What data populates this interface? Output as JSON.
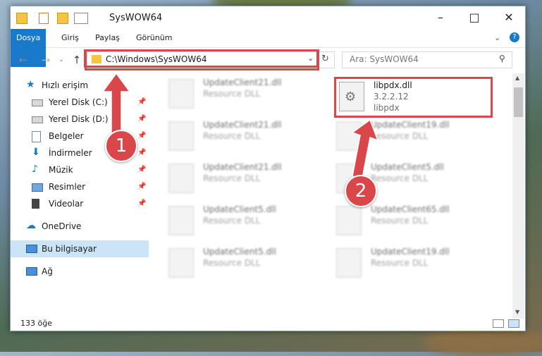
{
  "window": {
    "title": "SysWOW64"
  },
  "ribbon": {
    "tabs": [
      "Dosya",
      "Giriş",
      "Paylaş",
      "Görünüm"
    ]
  },
  "address": {
    "path": "C:\\Windows\\SysWOW64",
    "search_placeholder": "Ara: SysWOW64"
  },
  "sidebar": {
    "items": [
      {
        "label": "Hızlı erişim",
        "icon": "star-icon"
      },
      {
        "label": "Yerel Disk (C:)",
        "icon": "drive-icon",
        "pinned": true
      },
      {
        "label": "Yerel Disk (D:)",
        "icon": "drive-icon",
        "pinned": true
      },
      {
        "label": "Belgeler",
        "icon": "documents-icon",
        "pinned": true
      },
      {
        "label": "İndirmeler",
        "icon": "download-icon",
        "pinned": true
      },
      {
        "label": "Müzik",
        "icon": "music-icon",
        "pinned": true
      },
      {
        "label": "Resimler",
        "icon": "pictures-icon",
        "pinned": true
      },
      {
        "label": "Videolar",
        "icon": "video-icon",
        "pinned": true
      },
      {
        "label": "OneDrive",
        "icon": "cloud-icon"
      },
      {
        "label": "Bu bilgisayar",
        "icon": "computer-icon",
        "selected": true
      },
      {
        "label": "Ağ",
        "icon": "network-icon"
      }
    ]
  },
  "files": {
    "highlighted": {
      "name": "libpdx.dll",
      "version": "3.2.2.12",
      "desc": "libpdx"
    },
    "left": [
      {
        "name": "UpdateClient21.dll",
        "type": "Resource DLL"
      },
      {
        "name": "UpdateClient21.dll",
        "type": "Resource DLL"
      },
      {
        "name": "UpdateClient21.dll",
        "type": "Resource DLL"
      },
      {
        "name": "UpdateClient5.dll",
        "type": "Resource DLL"
      },
      {
        "name": "UpdateClient5.dll",
        "type": "Resource DLL"
      }
    ],
    "right": [
      {
        "name": "UpdateClient19.dll",
        "type": "Resource DLL"
      },
      {
        "name": "UpdateClient5.dll",
        "type": "Resource DLL"
      },
      {
        "name": "UpdateClient65.dll",
        "type": "Resource DLL"
      },
      {
        "name": "UpdateClient19.dll",
        "type": "Resource DLL"
      }
    ]
  },
  "status": {
    "count": "133 öğe"
  },
  "badges": [
    "1",
    "2"
  ],
  "colors": {
    "accent": "#1979ca",
    "highlight": "#d9474b",
    "selected": "#cce4f7"
  }
}
